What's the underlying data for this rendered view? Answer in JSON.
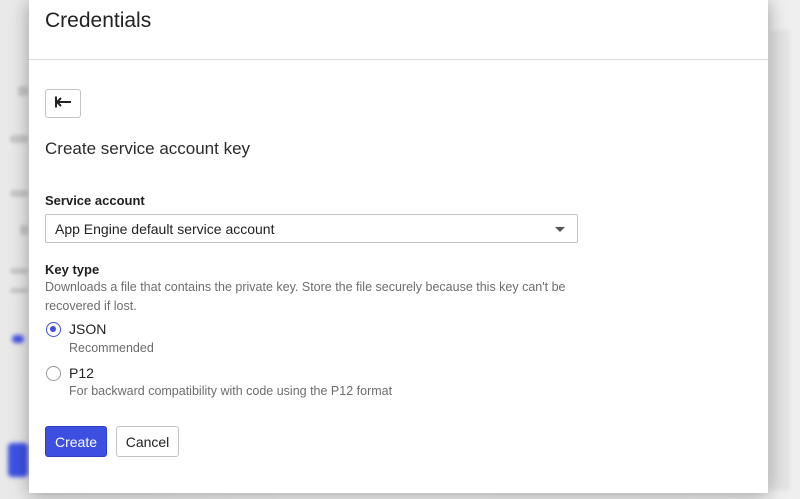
{
  "dialog": {
    "title": "Credentials",
    "subtitle": "Create service account key",
    "back_icon": "arrow-back-icon"
  },
  "service_account": {
    "label": "Service account",
    "selected": "App Engine default service account"
  },
  "key_type": {
    "label": "Key type",
    "description": "Downloads a file that contains the private key. Store the file securely because this key can't be recovered if lost.",
    "options": [
      {
        "label": "JSON",
        "hint": "Recommended",
        "selected": true
      },
      {
        "label": "P12",
        "hint": "For backward compatibility with code using the P12 format",
        "selected": false
      }
    ]
  },
  "actions": {
    "create_label": "Create",
    "cancel_label": "Cancel"
  },
  "colors": {
    "primary": "#3d4fe0",
    "border": "#c4c4c4",
    "hint_text": "#6d6d6d"
  }
}
